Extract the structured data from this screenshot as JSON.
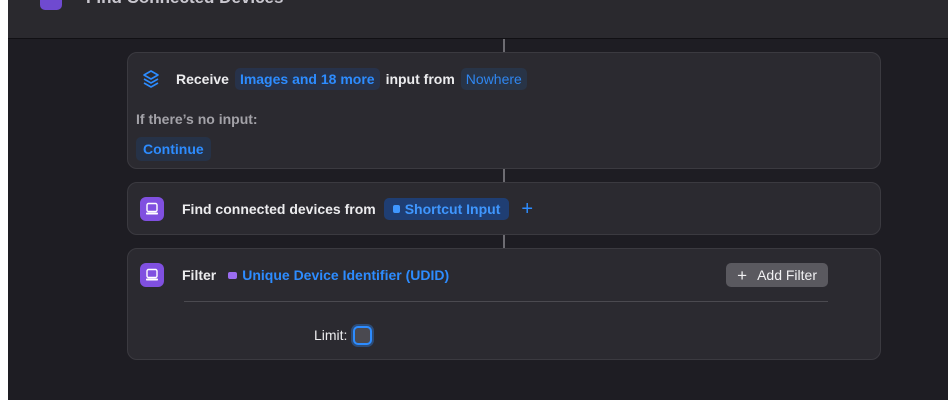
{
  "window": {
    "title": "Find Connected Devices"
  },
  "receive_action": {
    "receive_label": "Receive",
    "input_types": "Images and 18 more",
    "input_from_label": "input from",
    "source": "Nowhere",
    "no_input_label": "If there’s no input:",
    "no_input_action": "Continue",
    "icon": "layers-stack-icon"
  },
  "find_action": {
    "label": "Find connected devices from",
    "source": "Shortcut Input",
    "add_symbol": "+",
    "icon": "device-icon"
  },
  "filter_action": {
    "label": "Filter",
    "filter_field": "Unique Device Identifier (UDID)",
    "add_filter_symbol": "+",
    "add_filter_label": "Add Filter",
    "limit_label": "Limit:",
    "icon": "device-icon"
  },
  "colors": {
    "accent": "#2d8cff",
    "action_icon": "#8050e0",
    "background": "#1e1d23",
    "card": "#2b2a30"
  }
}
